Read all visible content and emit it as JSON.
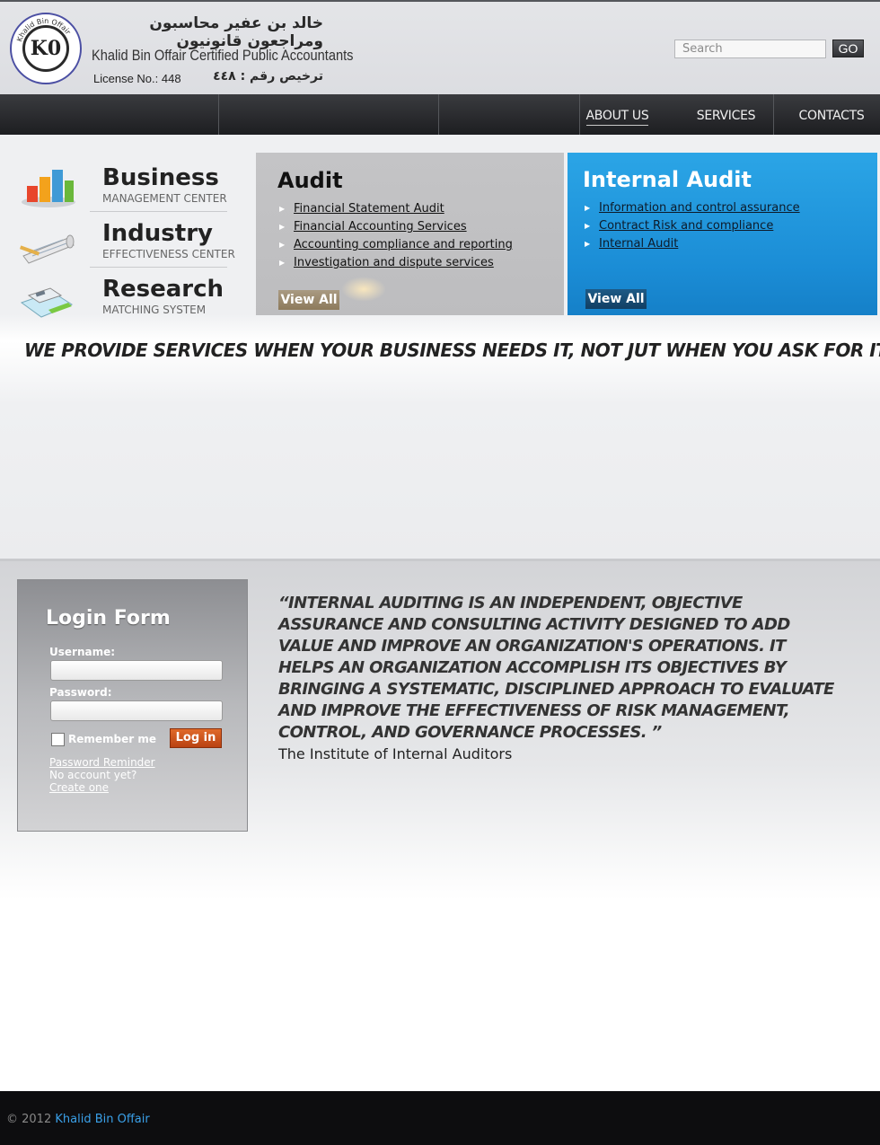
{
  "header": {
    "logo_text": "K0",
    "logo_ring_text": "Khalid Bin Offair",
    "arabic_name": "خالد بن عفير محاسبون ومراجعون قانونيون",
    "english_name": "Khalid Bin Offair Certified Public Accountants",
    "license_en": "License No.: 448",
    "license_ar": "ترخيص رقم : ٤٤٨",
    "search_placeholder": "Search",
    "go_label": "GO"
  },
  "nav": {
    "items": [
      {
        "label": "ABOUT US",
        "active": true
      },
      {
        "label": "SERVICES",
        "active": false
      },
      {
        "label": "CONTACTS",
        "active": false
      }
    ]
  },
  "centers": [
    {
      "title": "Business",
      "subtitle": "MANAGEMENT CENTER",
      "icon": "bar-chart-icon"
    },
    {
      "title": "Industry",
      "subtitle": "EFFECTIVENESS CENTER",
      "icon": "blueprint-icon"
    },
    {
      "title": "Research",
      "subtitle": "MATCHING SYSTEM",
      "icon": "calculator-icon"
    }
  ],
  "audit": {
    "title": "Audit",
    "items": [
      "Financial Statement Audit",
      "Financial Accounting Services",
      "Accounting compliance and reporting",
      "Investigation and dispute services"
    ],
    "view_all": "View All"
  },
  "internal_audit": {
    "title": "Internal Audit",
    "items": [
      "Information and control assurance",
      "Contract Risk and compliance",
      "Internal Audit"
    ],
    "view_all": "View All"
  },
  "tagline": "WE PROVIDE SERVICES WHEN YOUR BUSINESS NEEDS IT, NOT JUT WHEN YOU ASK FOR IT.",
  "login": {
    "title": "Login Form",
    "username_label": "Username:",
    "password_label": "Password:",
    "remember_label": "Remember me",
    "login_button": "Log in",
    "password_reminder": "Password Reminder",
    "no_account": "No account yet?",
    "create_one": "Create one"
  },
  "quote": {
    "text": "“INTERNAL AUDITING IS AN INDEPENDENT, OBJECTIVE ASSURANCE AND CONSULTING ACTIVITY DESIGNED TO ADD VALUE AND IMPROVE AN ORGANIZATION'S OPERATIONS. IT HELPS AN ORGANIZATION ACCOMPLISH ITS OBJECTIVES BY BRINGING A SYSTEMATIC, DISCIPLINED APPROACH TO EVALUATE AND IMPROVE THE EFFECTIVENESS OF RISK MANAGEMENT, CONTROL, AND GOVERNANCE PROCESSES. ”",
    "source": "The Institute of Internal Auditors"
  },
  "footer": {
    "copyright": "© 2012",
    "brand": "Khalid Bin Offair"
  },
  "colors": {
    "nav_bg": "#1d1e21",
    "audit_panel": "#c4c4c6",
    "internal_panel": "#1b8dd6",
    "login_button": "#c9501a",
    "footer_bg": "#0d0d0f",
    "brand_link": "#3aa0e8"
  }
}
